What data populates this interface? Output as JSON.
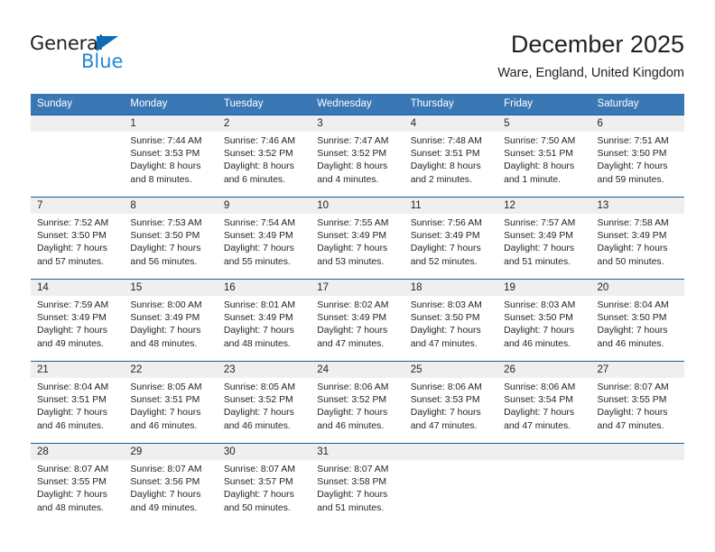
{
  "brand": {
    "name_part1": "General",
    "name_part2": "Blue",
    "accent_color": "#2387d1",
    "triangle_color": "#0b6cb7"
  },
  "header": {
    "title": "December 2025",
    "subtitle": "Ware, England, United Kingdom"
  },
  "theme": {
    "header_row_bg": "#3a78b5",
    "week_divider": "#1b5c9e",
    "daynum_band_bg": "#efefef",
    "text_color": "#231f20"
  },
  "weekdays": [
    "Sunday",
    "Monday",
    "Tuesday",
    "Wednesday",
    "Thursday",
    "Friday",
    "Saturday"
  ],
  "labels": {
    "sunrise": "Sunrise:",
    "sunset": "Sunset:",
    "daylight": "Daylight:"
  },
  "weeks": [
    [
      {
        "day": "",
        "empty": true
      },
      {
        "day": "1",
        "sunrise": "Sunrise: 7:44 AM",
        "sunset": "Sunset: 3:53 PM",
        "daylight1": "Daylight: 8 hours",
        "daylight2": "and 8 minutes."
      },
      {
        "day": "2",
        "sunrise": "Sunrise: 7:46 AM",
        "sunset": "Sunset: 3:52 PM",
        "daylight1": "Daylight: 8 hours",
        "daylight2": "and 6 minutes."
      },
      {
        "day": "3",
        "sunrise": "Sunrise: 7:47 AM",
        "sunset": "Sunset: 3:52 PM",
        "daylight1": "Daylight: 8 hours",
        "daylight2": "and 4 minutes."
      },
      {
        "day": "4",
        "sunrise": "Sunrise: 7:48 AM",
        "sunset": "Sunset: 3:51 PM",
        "daylight1": "Daylight: 8 hours",
        "daylight2": "and 2 minutes."
      },
      {
        "day": "5",
        "sunrise": "Sunrise: 7:50 AM",
        "sunset": "Sunset: 3:51 PM",
        "daylight1": "Daylight: 8 hours",
        "daylight2": "and 1 minute."
      },
      {
        "day": "6",
        "sunrise": "Sunrise: 7:51 AM",
        "sunset": "Sunset: 3:50 PM",
        "daylight1": "Daylight: 7 hours",
        "daylight2": "and 59 minutes."
      }
    ],
    [
      {
        "day": "7",
        "sunrise": "Sunrise: 7:52 AM",
        "sunset": "Sunset: 3:50 PM",
        "daylight1": "Daylight: 7 hours",
        "daylight2": "and 57 minutes."
      },
      {
        "day": "8",
        "sunrise": "Sunrise: 7:53 AM",
        "sunset": "Sunset: 3:50 PM",
        "daylight1": "Daylight: 7 hours",
        "daylight2": "and 56 minutes."
      },
      {
        "day": "9",
        "sunrise": "Sunrise: 7:54 AM",
        "sunset": "Sunset: 3:49 PM",
        "daylight1": "Daylight: 7 hours",
        "daylight2": "and 55 minutes."
      },
      {
        "day": "10",
        "sunrise": "Sunrise: 7:55 AM",
        "sunset": "Sunset: 3:49 PM",
        "daylight1": "Daylight: 7 hours",
        "daylight2": "and 53 minutes."
      },
      {
        "day": "11",
        "sunrise": "Sunrise: 7:56 AM",
        "sunset": "Sunset: 3:49 PM",
        "daylight1": "Daylight: 7 hours",
        "daylight2": "and 52 minutes."
      },
      {
        "day": "12",
        "sunrise": "Sunrise: 7:57 AM",
        "sunset": "Sunset: 3:49 PM",
        "daylight1": "Daylight: 7 hours",
        "daylight2": "and 51 minutes."
      },
      {
        "day": "13",
        "sunrise": "Sunrise: 7:58 AM",
        "sunset": "Sunset: 3:49 PM",
        "daylight1": "Daylight: 7 hours",
        "daylight2": "and 50 minutes."
      }
    ],
    [
      {
        "day": "14",
        "sunrise": "Sunrise: 7:59 AM",
        "sunset": "Sunset: 3:49 PM",
        "daylight1": "Daylight: 7 hours",
        "daylight2": "and 49 minutes."
      },
      {
        "day": "15",
        "sunrise": "Sunrise: 8:00 AM",
        "sunset": "Sunset: 3:49 PM",
        "daylight1": "Daylight: 7 hours",
        "daylight2": "and 48 minutes."
      },
      {
        "day": "16",
        "sunrise": "Sunrise: 8:01 AM",
        "sunset": "Sunset: 3:49 PM",
        "daylight1": "Daylight: 7 hours",
        "daylight2": "and 48 minutes."
      },
      {
        "day": "17",
        "sunrise": "Sunrise: 8:02 AM",
        "sunset": "Sunset: 3:49 PM",
        "daylight1": "Daylight: 7 hours",
        "daylight2": "and 47 minutes."
      },
      {
        "day": "18",
        "sunrise": "Sunrise: 8:03 AM",
        "sunset": "Sunset: 3:50 PM",
        "daylight1": "Daylight: 7 hours",
        "daylight2": "and 47 minutes."
      },
      {
        "day": "19",
        "sunrise": "Sunrise: 8:03 AM",
        "sunset": "Sunset: 3:50 PM",
        "daylight1": "Daylight: 7 hours",
        "daylight2": "and 46 minutes."
      },
      {
        "day": "20",
        "sunrise": "Sunrise: 8:04 AM",
        "sunset": "Sunset: 3:50 PM",
        "daylight1": "Daylight: 7 hours",
        "daylight2": "and 46 minutes."
      }
    ],
    [
      {
        "day": "21",
        "sunrise": "Sunrise: 8:04 AM",
        "sunset": "Sunset: 3:51 PM",
        "daylight1": "Daylight: 7 hours",
        "daylight2": "and 46 minutes."
      },
      {
        "day": "22",
        "sunrise": "Sunrise: 8:05 AM",
        "sunset": "Sunset: 3:51 PM",
        "daylight1": "Daylight: 7 hours",
        "daylight2": "and 46 minutes."
      },
      {
        "day": "23",
        "sunrise": "Sunrise: 8:05 AM",
        "sunset": "Sunset: 3:52 PM",
        "daylight1": "Daylight: 7 hours",
        "daylight2": "and 46 minutes."
      },
      {
        "day": "24",
        "sunrise": "Sunrise: 8:06 AM",
        "sunset": "Sunset: 3:52 PM",
        "daylight1": "Daylight: 7 hours",
        "daylight2": "and 46 minutes."
      },
      {
        "day": "25",
        "sunrise": "Sunrise: 8:06 AM",
        "sunset": "Sunset: 3:53 PM",
        "daylight1": "Daylight: 7 hours",
        "daylight2": "and 47 minutes."
      },
      {
        "day": "26",
        "sunrise": "Sunrise: 8:06 AM",
        "sunset": "Sunset: 3:54 PM",
        "daylight1": "Daylight: 7 hours",
        "daylight2": "and 47 minutes."
      },
      {
        "day": "27",
        "sunrise": "Sunrise: 8:07 AM",
        "sunset": "Sunset: 3:55 PM",
        "daylight1": "Daylight: 7 hours",
        "daylight2": "and 47 minutes."
      }
    ],
    [
      {
        "day": "28",
        "sunrise": "Sunrise: 8:07 AM",
        "sunset": "Sunset: 3:55 PM",
        "daylight1": "Daylight: 7 hours",
        "daylight2": "and 48 minutes."
      },
      {
        "day": "29",
        "sunrise": "Sunrise: 8:07 AM",
        "sunset": "Sunset: 3:56 PM",
        "daylight1": "Daylight: 7 hours",
        "daylight2": "and 49 minutes."
      },
      {
        "day": "30",
        "sunrise": "Sunrise: 8:07 AM",
        "sunset": "Sunset: 3:57 PM",
        "daylight1": "Daylight: 7 hours",
        "daylight2": "and 50 minutes."
      },
      {
        "day": "31",
        "sunrise": "Sunrise: 8:07 AM",
        "sunset": "Sunset: 3:58 PM",
        "daylight1": "Daylight: 7 hours",
        "daylight2": "and 51 minutes."
      },
      {
        "day": "",
        "empty": true
      },
      {
        "day": "",
        "empty": true
      },
      {
        "day": "",
        "empty": true
      }
    ]
  ]
}
